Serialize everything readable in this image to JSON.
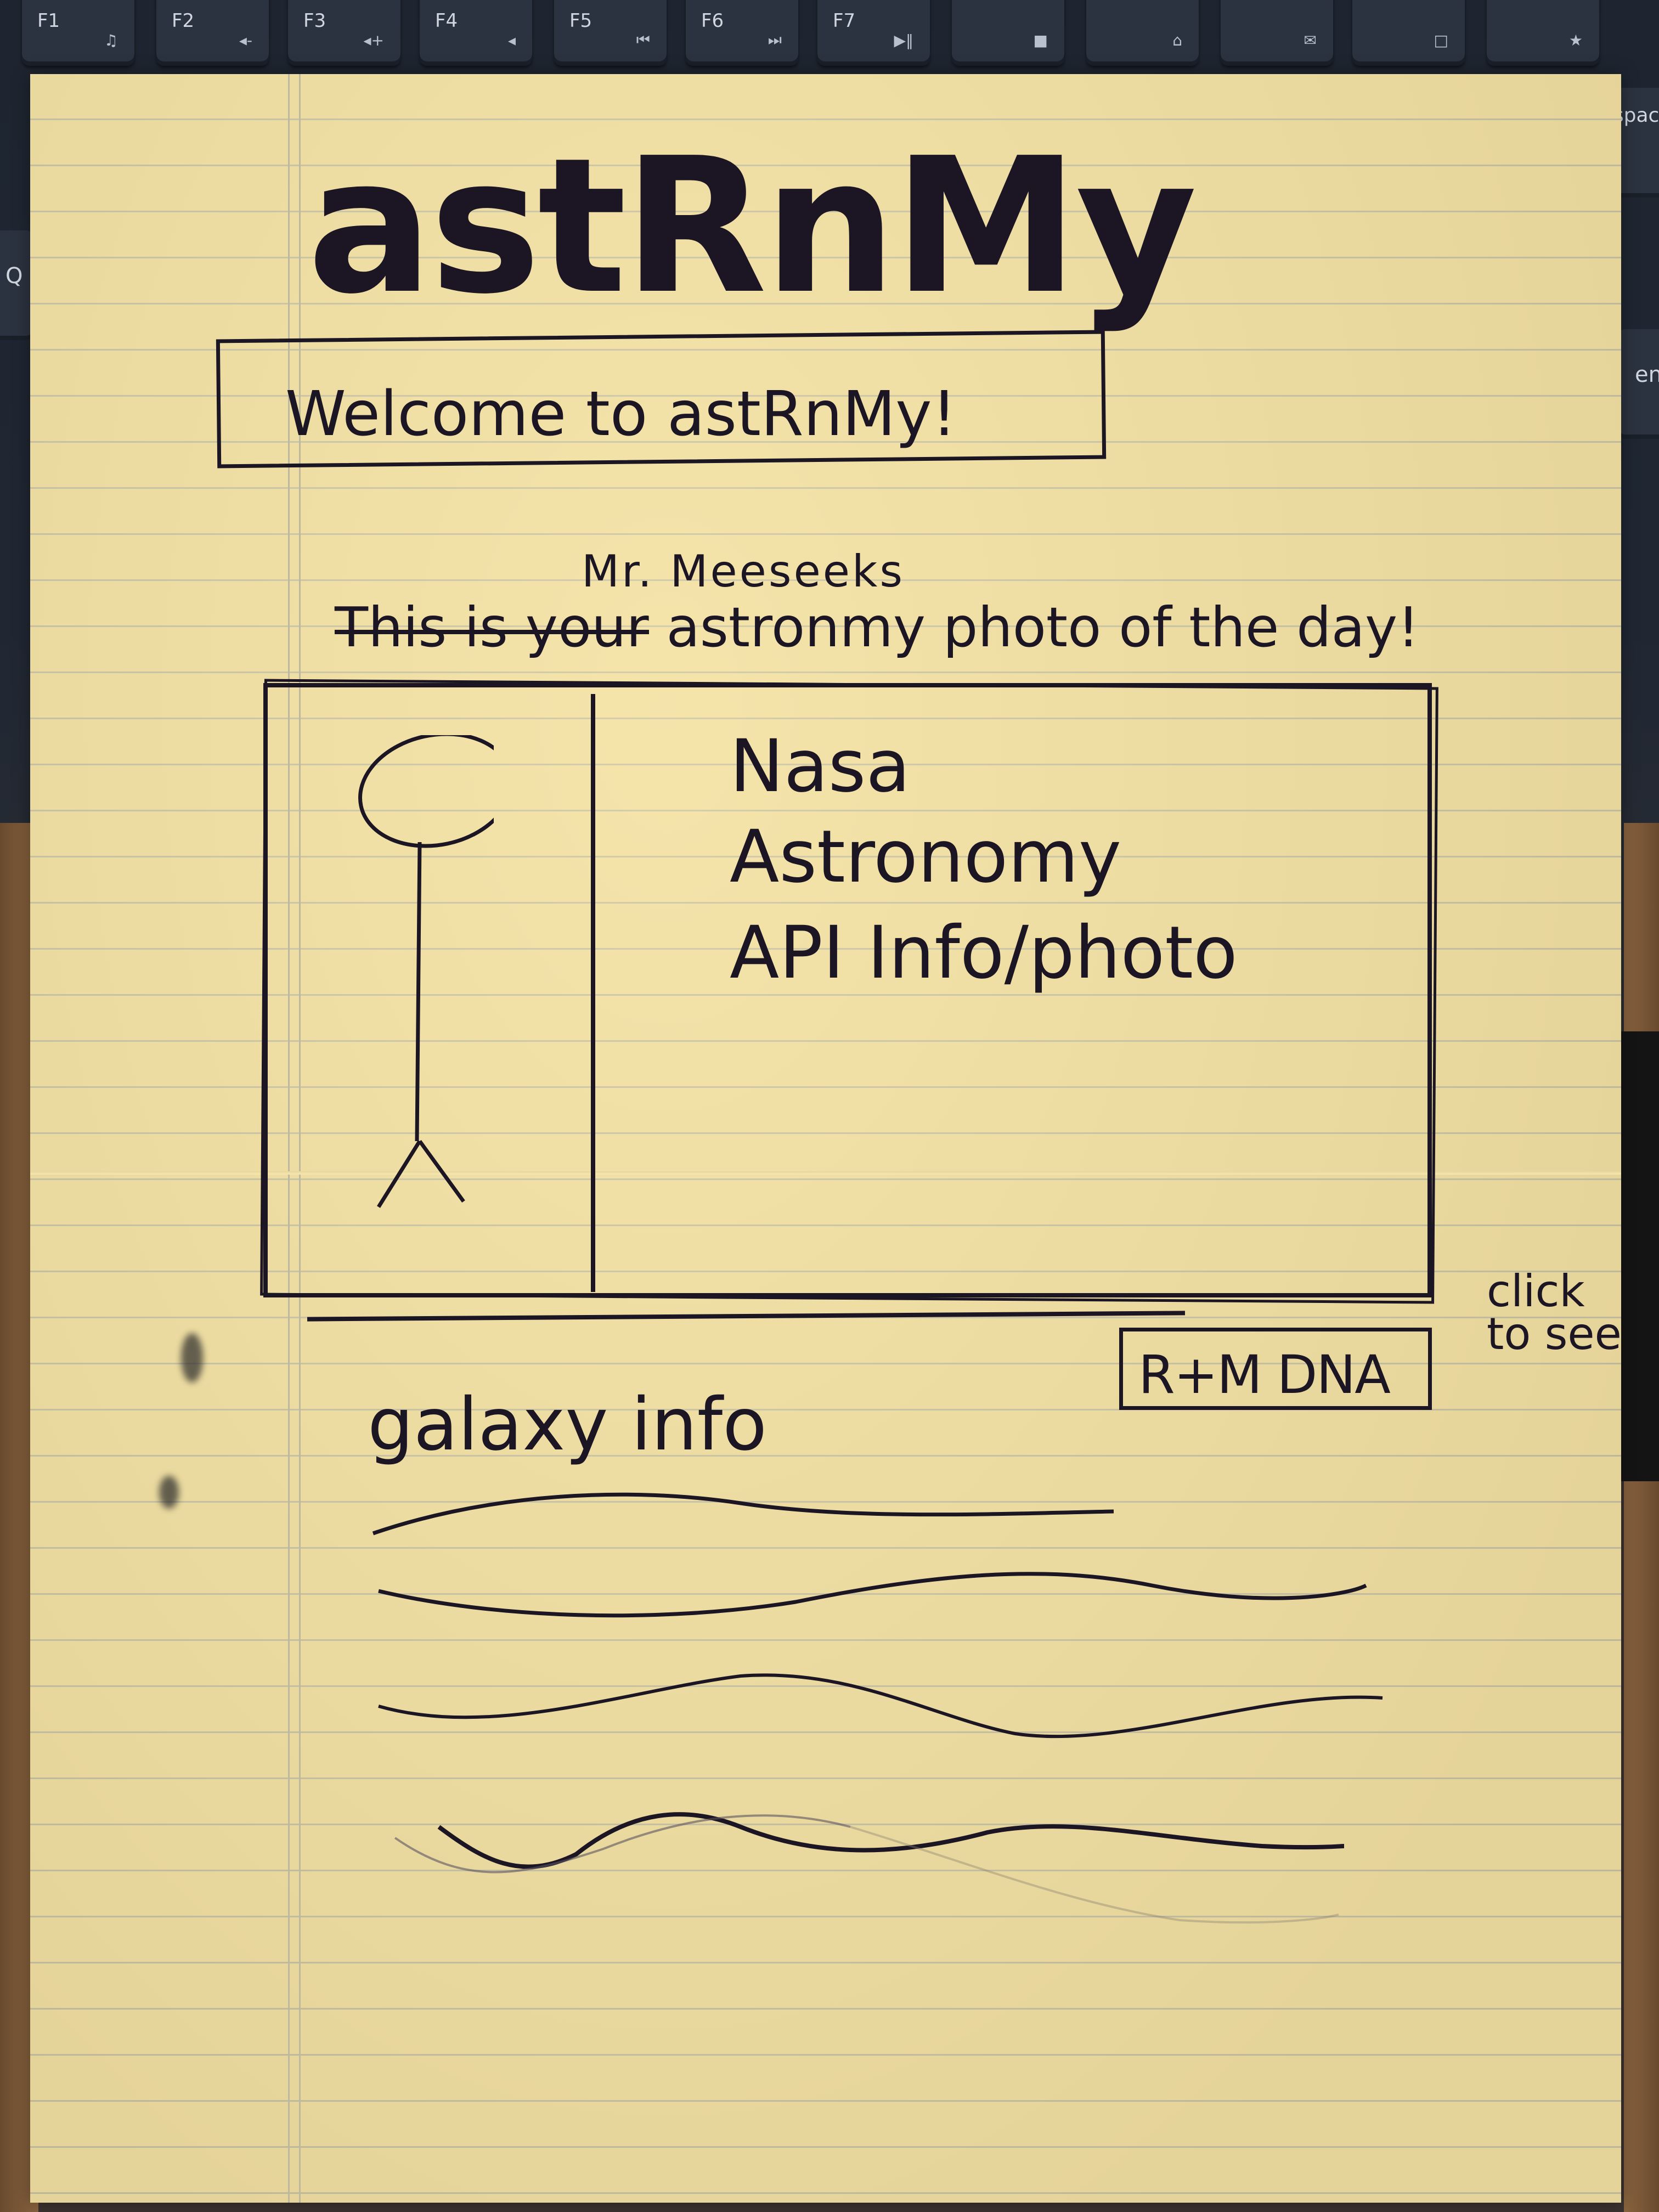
{
  "keyboard": {
    "keys": [
      {
        "label": "F1",
        "icon": "music-note-icon",
        "glyph": "♫"
      },
      {
        "label": "F2",
        "icon": "volume-down-icon",
        "glyph": "◂-"
      },
      {
        "label": "F3",
        "icon": "volume-up-icon",
        "glyph": "◂+"
      },
      {
        "label": "F4",
        "icon": "mute-icon",
        "glyph": "◂"
      },
      {
        "label": "F5",
        "icon": "previous-track-icon",
        "glyph": "⏮"
      },
      {
        "label": "F6",
        "icon": "next-track-icon",
        "glyph": "⏭"
      },
      {
        "label": "F7",
        "icon": "play-pause-icon",
        "glyph": "▶‖"
      },
      {
        "label": "",
        "icon": "stop-icon",
        "glyph": "■"
      },
      {
        "label": "",
        "icon": "home-icon",
        "glyph": "⌂"
      },
      {
        "label": "",
        "icon": "mail-icon",
        "glyph": "✉"
      },
      {
        "label": "",
        "icon": "device-icon",
        "glyph": "□"
      },
      {
        "label": "",
        "icon": "star-icon",
        "glyph": "★"
      }
    ],
    "side_keys": [
      "Q",
      "kspac",
      "en"
    ]
  },
  "sketch": {
    "title": "astRnMy",
    "welcome": "Welcome to astRnMy!",
    "name_insert": "Mr. Meeseeks",
    "subtitle_struck": "This is your",
    "subtitle_rest": "astronmy photo of the day!",
    "api_lines": [
      "Nasa",
      "Astronomy",
      "API Info/photo"
    ],
    "button_label": "R+M DNA",
    "click_note": "click\nto see",
    "galaxy_heading": "galaxy info"
  },
  "colors": {
    "paper": "#f1dfa1",
    "ink": "#1c1624",
    "keyboard": "#202733"
  }
}
